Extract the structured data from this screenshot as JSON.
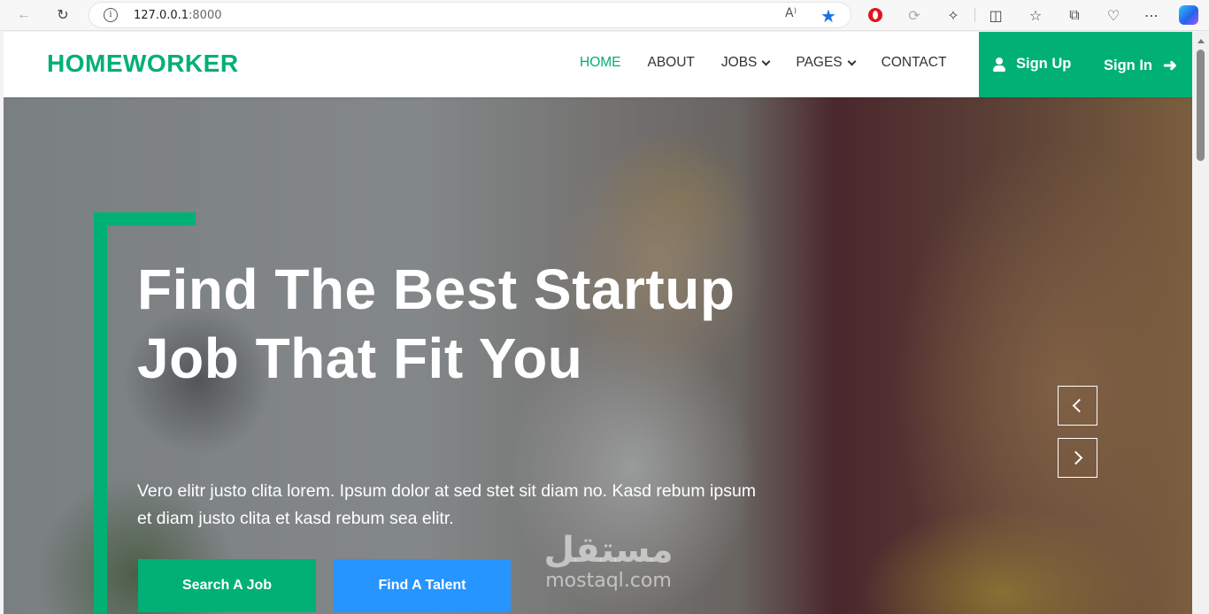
{
  "browser": {
    "url_host": "127.0.0.1",
    "url_port": ":8000",
    "read_aloud_glyph": "A⁾",
    "icons": [
      "back-icon",
      "refresh-icon",
      "info-icon",
      "read-aloud-icon",
      "favorite-star-icon",
      "opera-extension-icon",
      "sync-icon",
      "extensions-icon",
      "split-screen-icon",
      "favorites-icon",
      "collections-icon",
      "performance-icon",
      "more-icon",
      "copilot-icon"
    ]
  },
  "nav": {
    "brand": "HOMEWORKER",
    "items": [
      {
        "label": "HOME",
        "active": true
      },
      {
        "label": "ABOUT"
      },
      {
        "label": "JOBS",
        "dropdown": true
      },
      {
        "label": "PAGES",
        "dropdown": true
      },
      {
        "label": "CONTACT"
      }
    ],
    "signup": "Sign Up",
    "signin": "Sign In"
  },
  "hero": {
    "headline": "Find The Best Startup Job That Fit You",
    "subtext": "Vero elitr justo clita lorem. Ipsum dolor at sed stet sit diam no. Kasd rebum ipsum et diam justo clita et kasd rebum sea elitr.",
    "primary_button": "Search A Job",
    "secondary_button": "Find A Talent"
  },
  "watermark": {
    "arabic": "مستقل",
    "latin": "mostaql.com"
  },
  "colors": {
    "accent": "#00b074",
    "secondary": "#2795ff"
  }
}
